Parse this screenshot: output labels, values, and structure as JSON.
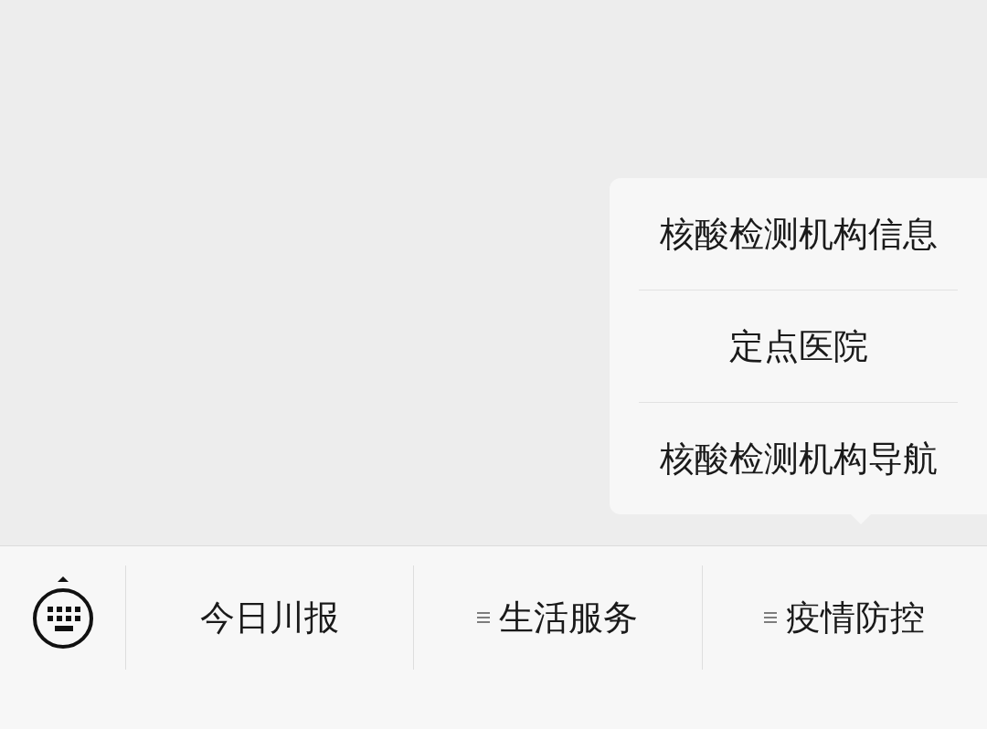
{
  "menu_bar": {
    "items": [
      {
        "label": "今日川报",
        "has_submenu": false,
        "expanded": false
      },
      {
        "label": "生活服务",
        "has_submenu": true,
        "expanded": false
      },
      {
        "label": "疫情防控",
        "has_submenu": true,
        "expanded": true,
        "submenu": [
          "核酸检测机构信息",
          "定点医院",
          "核酸检测机构导航"
        ]
      }
    ]
  }
}
